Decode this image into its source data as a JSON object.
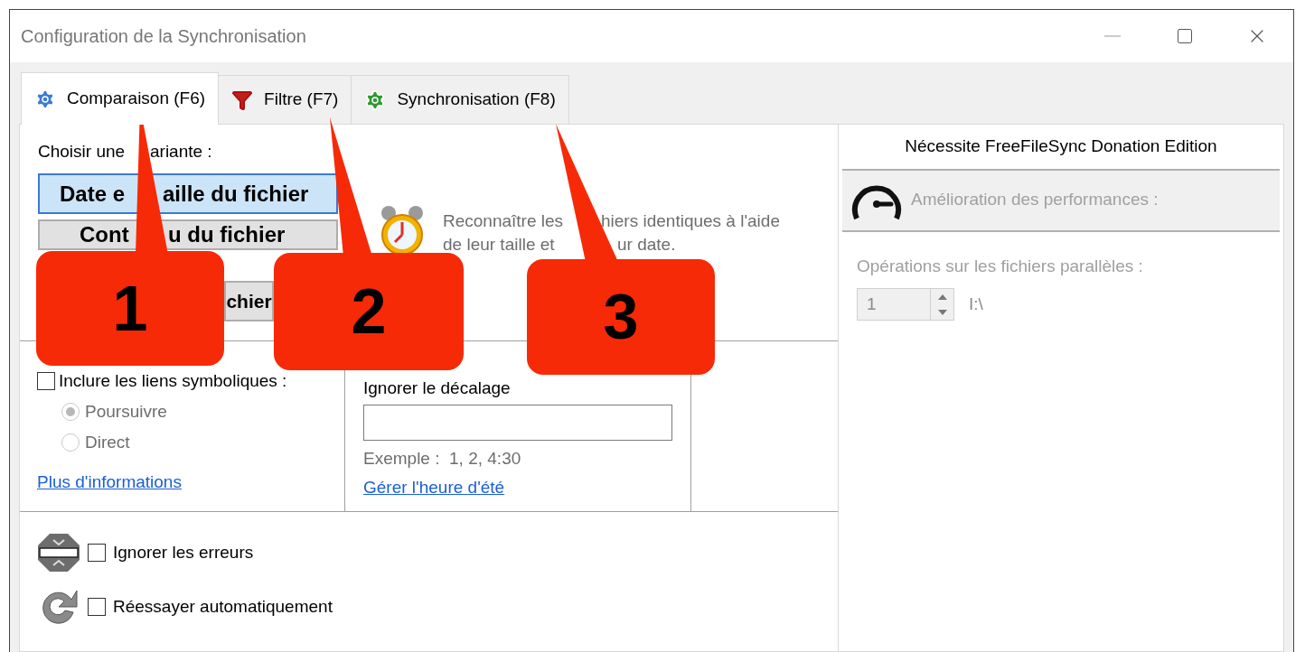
{
  "window": {
    "title": "Configuration de la Synchronisation"
  },
  "tabs": [
    {
      "label": "Comparaison (F6)",
      "selected": true,
      "kind": "compare"
    },
    {
      "label": "Filtre (F7)",
      "selected": false,
      "kind": "filter"
    },
    {
      "label": "Synchronisation (F8)",
      "selected": false,
      "kind": "sync"
    }
  ],
  "comparison": {
    "prompt": [
      "Choisir une",
      "ariante :"
    ],
    "variants": [
      {
        "label": [
          "Date e",
          "aille du fichier"
        ],
        "selected": true
      },
      {
        "label": [
          "Cont",
          "u du fichier"
        ],
        "selected": false
      },
      {
        "label": [
          "chier"
        ],
        "selected": false
      }
    ],
    "description_lines": [
      [
        "Reconnaître les",
        "hiers identiques à l'aide"
      ],
      [
        "de leur taille et",
        "ur date."
      ]
    ]
  },
  "symlinks": {
    "label": "Inclure les liens symboliques :",
    "checked": false,
    "options": [
      {
        "label": "Poursuivre",
        "selected": true
      },
      {
        "label": "Direct",
        "selected": false
      }
    ],
    "link": "Plus d'informations"
  },
  "time_shift": {
    "label": "Ignorer le décalage",
    "example": "Exemple :  1, 2, 4:30",
    "link": "Gérer l'heure d'été"
  },
  "error_handling": [
    {
      "label": "Ignorer les erreurs",
      "checked": false,
      "kind": "ignore"
    },
    {
      "label": "Réessayer automatiquement",
      "checked": false,
      "kind": "retry"
    }
  ],
  "performance": {
    "notice": "Nécessite FreeFileSync Donation Edition",
    "title": "Amélioration des performances :",
    "label": "Opérations sur les fichiers parallèles :",
    "value": "1",
    "device": "I:\\"
  },
  "callouts": [
    {
      "label": "1"
    },
    {
      "label": "2"
    },
    {
      "label": "3"
    }
  ]
}
